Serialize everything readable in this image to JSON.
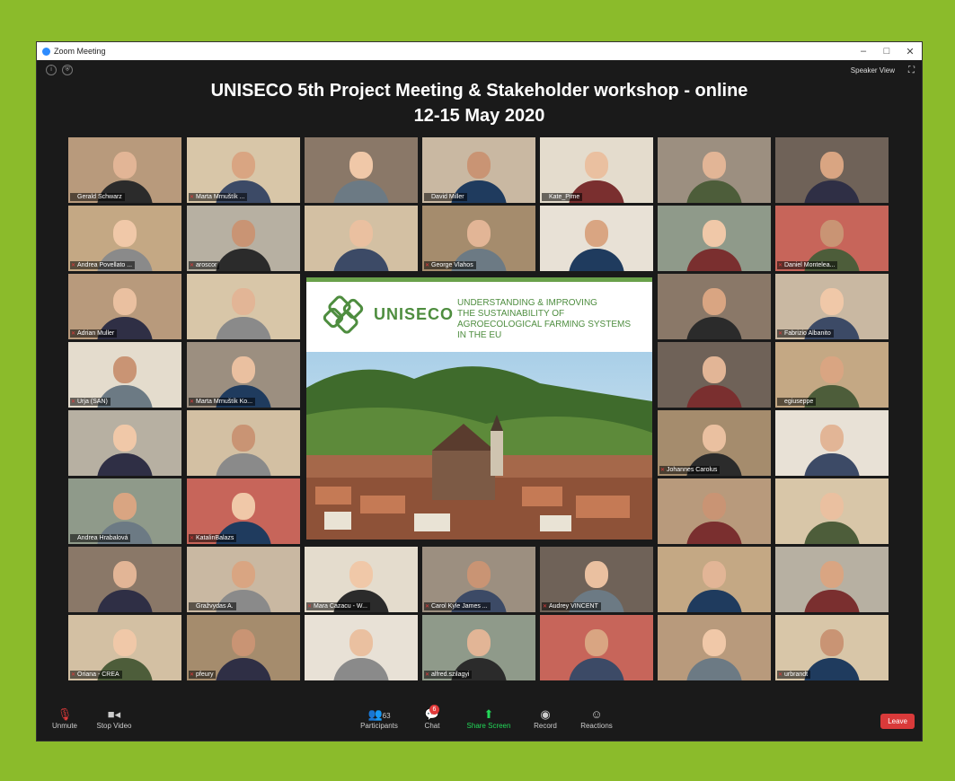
{
  "window": {
    "title": "Zoom Meeting",
    "controls": [
      "–",
      "□",
      "✕"
    ]
  },
  "topbar": {
    "speaker_view": "Speaker View"
  },
  "meeting": {
    "title_line1": "UNISECO 5th Project Meeting & Stakeholder workshop - online",
    "title_line2": "12-15 May 2020"
  },
  "participants": [
    {
      "name": "Gerald Schwarz",
      "muted": false
    },
    {
      "name": "Marta Mrnuštík ...",
      "muted": true
    },
    {
      "name": "",
      "muted": false
    },
    {
      "name": "David Miller",
      "muted": false
    },
    {
      "name": "Kate_Pime",
      "muted": false
    },
    {
      "name": "",
      "muted": false
    },
    {
      "name": "",
      "muted": false
    },
    {
      "name": "Andrea Povellato ...",
      "muted": true
    },
    {
      "name": "aroscor",
      "muted": true
    },
    {
      "name": "",
      "muted": false
    },
    {
      "name": "George Vlahos",
      "muted": true
    },
    {
      "name": "",
      "muted": false
    },
    {
      "name": "",
      "muted": false
    },
    {
      "name": "Daniel Montelea...",
      "muted": true
    },
    {
      "name": "Adrian Muller",
      "muted": true
    },
    {
      "name": "",
      "muted": false
    },
    {
      "name": "",
      "muted": false
    },
    {
      "name": "Fabrizio Albanito",
      "muted": true
    },
    {
      "name": "Urja (SAN)",
      "muted": true
    },
    {
      "name": "Marta Mrnuštík Ko...",
      "muted": true
    },
    {
      "name": "",
      "muted": false
    },
    {
      "name": "egiuseppe",
      "muted": false
    },
    {
      "name": "",
      "muted": false
    },
    {
      "name": "",
      "muted": false
    },
    {
      "name": "Johannes Carolus",
      "muted": true
    },
    {
      "name": "",
      "muted": false
    },
    {
      "name": "Andrea Hrabalová",
      "muted": false
    },
    {
      "name": "KatalinBalazs",
      "muted": true
    },
    {
      "name": "",
      "muted": false
    },
    {
      "name": "",
      "muted": false
    },
    {
      "name": "",
      "muted": false
    },
    {
      "name": "Gražvydas A.",
      "muted": false
    },
    {
      "name": "Mara Cazacu - W...",
      "muted": true
    },
    {
      "name": "Carol Kyle James ...",
      "muted": true
    },
    {
      "name": "Audrey VINCENT",
      "muted": true
    },
    {
      "name": "",
      "muted": false
    },
    {
      "name": "",
      "muted": false
    },
    {
      "name": "Oriana - CREA",
      "muted": true
    },
    {
      "name": "pfeury",
      "muted": true
    },
    {
      "name": "",
      "muted": false
    },
    {
      "name": "alfred.szilagyi",
      "muted": true
    },
    {
      "name": "",
      "muted": false
    },
    {
      "name": "",
      "muted": false
    },
    {
      "name": "urbrandt",
      "muted": true
    }
  ],
  "slide": {
    "brand": "UNISECO",
    "headline_lines": [
      "UNDERSTANDING & IMPROVING",
      "THE SUSTAINABILITY OF",
      "AGROECOLOGICAL FARMING SYSTEMS",
      "IN THE EU"
    ]
  },
  "toolbar": {
    "unmute": "Unmute",
    "stop_video": "Stop Video",
    "participants_label": "Participants",
    "participants_count": "63",
    "chat": "Chat",
    "chat_badge": "6",
    "share_screen": "Share Screen",
    "record": "Record",
    "reactions": "Reactions",
    "leave": "Leave"
  },
  "colors": {
    "page_bg": "#8bbb2b",
    "window_bg": "#1a1a1a",
    "share_green": "#23d959",
    "leave_red": "#d93a3a",
    "slide_green": "#4e8d3f"
  }
}
